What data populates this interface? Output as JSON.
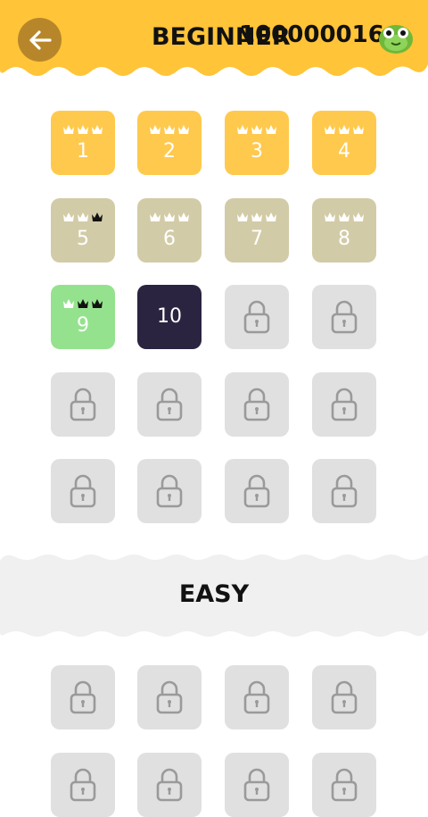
{
  "header": {
    "back_icon": "arrow-left-icon",
    "title": "Beginner",
    "score": "100000016",
    "avatar_icon": "green-creature-avatar-icon"
  },
  "colors": {
    "header": "#ffc438",
    "gold_tile": "#ffc94d",
    "tan_tile": "#d2cba7",
    "green_tile": "#95e28e",
    "current_tile": "#2a2440",
    "locked_tile": "#e0e0e0"
  },
  "levels": [
    {
      "label": "1",
      "state": "gold",
      "crowns": [
        0,
        0,
        0
      ]
    },
    {
      "label": "2",
      "state": "gold",
      "crowns": [
        0,
        0,
        0
      ]
    },
    {
      "label": "3",
      "state": "gold",
      "crowns": [
        0,
        0,
        0
      ]
    },
    {
      "label": "4",
      "state": "gold",
      "crowns": [
        0,
        0,
        0
      ]
    },
    {
      "label": "5",
      "state": "tan",
      "crowns": [
        0,
        0,
        1
      ]
    },
    {
      "label": "6",
      "state": "tan",
      "crowns": [
        0,
        0,
        0
      ]
    },
    {
      "label": "7",
      "state": "tan",
      "crowns": [
        0,
        0,
        0
      ]
    },
    {
      "label": "8",
      "state": "tan",
      "crowns": [
        0,
        0,
        0
      ]
    },
    {
      "label": "9",
      "state": "green",
      "crowns": [
        0,
        1,
        1
      ]
    },
    {
      "label": "10",
      "state": "current",
      "crowns": []
    },
    {
      "label": "",
      "state": "locked"
    },
    {
      "label": "",
      "state": "locked"
    },
    {
      "label": "",
      "state": "locked"
    },
    {
      "label": "",
      "state": "locked"
    },
    {
      "label": "",
      "state": "locked"
    },
    {
      "label": "",
      "state": "locked"
    },
    {
      "label": "",
      "state": "locked"
    },
    {
      "label": "",
      "state": "locked"
    },
    {
      "label": "",
      "state": "locked"
    },
    {
      "label": "",
      "state": "locked"
    }
  ],
  "section": {
    "title": "Easy"
  },
  "easy_levels": [
    {
      "label": "",
      "state": "locked"
    },
    {
      "label": "",
      "state": "locked"
    },
    {
      "label": "",
      "state": "locked"
    },
    {
      "label": "",
      "state": "locked"
    },
    {
      "label": "",
      "state": "locked"
    },
    {
      "label": "",
      "state": "locked"
    },
    {
      "label": "",
      "state": "locked"
    },
    {
      "label": "",
      "state": "locked"
    }
  ]
}
